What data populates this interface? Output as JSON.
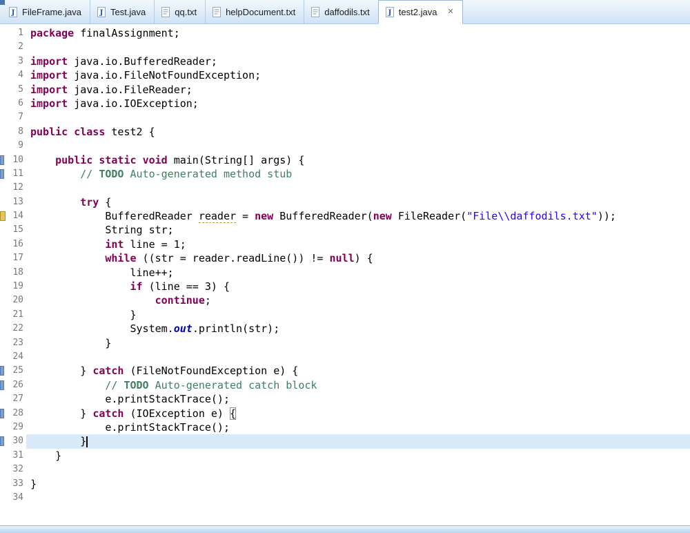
{
  "tab_close_glyph": "✕",
  "tabs": [
    {
      "label": "FileFrame.java",
      "type": "java",
      "active": false
    },
    {
      "label": "Test.java",
      "type": "java",
      "active": false
    },
    {
      "label": "qq.txt",
      "type": "txt",
      "active": false
    },
    {
      "label": "helpDocument.txt",
      "type": "txt",
      "active": false
    },
    {
      "label": "daffodils.txt",
      "type": "txt",
      "active": false
    },
    {
      "label": "test2.java",
      "type": "java",
      "active": true
    }
  ],
  "editor": {
    "language": "java",
    "line_count": 34,
    "current_line": 30,
    "cursor_line": 30,
    "markers": [
      {
        "line": 10,
        "color": "blue",
        "name": "range-marker"
      },
      {
        "line": 11,
        "color": "blue",
        "name": "task-marker"
      },
      {
        "line": 14,
        "color": "gold",
        "name": "warning-marker"
      },
      {
        "line": 25,
        "color": "blue",
        "name": "range-marker"
      },
      {
        "line": 26,
        "color": "blue",
        "name": "task-marker"
      },
      {
        "line": 28,
        "color": "blue",
        "name": "range-marker"
      },
      {
        "line": 30,
        "color": "blue",
        "name": "range-marker"
      }
    ],
    "lines": [
      [
        [
          "k",
          "package"
        ],
        [
          "p",
          " finalAssignment;"
        ]
      ],
      [],
      [
        [
          "k",
          "import"
        ],
        [
          "p",
          " java.io.BufferedReader;"
        ]
      ],
      [
        [
          "k",
          "import"
        ],
        [
          "p",
          " java.io.FileNotFoundException;"
        ]
      ],
      [
        [
          "k",
          "import"
        ],
        [
          "p",
          " java.io.FileReader;"
        ]
      ],
      [
        [
          "k",
          "import"
        ],
        [
          "p",
          " java.io.IOException;"
        ]
      ],
      [],
      [
        [
          "k",
          "public"
        ],
        [
          "p",
          " "
        ],
        [
          "k",
          "class"
        ],
        [
          "p",
          " test2 {"
        ]
      ],
      [],
      [
        [
          "p",
          "\t"
        ],
        [
          "k",
          "public"
        ],
        [
          "p",
          " "
        ],
        [
          "k",
          "static"
        ],
        [
          "p",
          " "
        ],
        [
          "k",
          "void"
        ],
        [
          "p",
          " main(String[] args) {"
        ]
      ],
      [
        [
          "c",
          "\t\t// "
        ],
        [
          "t",
          "TODO"
        ],
        [
          "c",
          " Auto-generated method stub"
        ]
      ],
      [],
      [
        [
          "p",
          "\t\t"
        ],
        [
          "k",
          "try"
        ],
        [
          "p",
          " {"
        ]
      ],
      [
        [
          "p",
          "\t\t\tBufferedReader "
        ],
        [
          "u",
          "reader"
        ],
        [
          "p",
          " = "
        ],
        [
          "k",
          "new"
        ],
        [
          "p",
          " BufferedReader("
        ],
        [
          "k",
          "new"
        ],
        [
          "p",
          " FileReader("
        ],
        [
          "s",
          "\"File\\\\daffodils.txt\""
        ],
        [
          "p",
          "));"
        ]
      ],
      [
        [
          "p",
          "\t\t\tString str;"
        ]
      ],
      [
        [
          "p",
          "\t\t\t"
        ],
        [
          "k",
          "int"
        ],
        [
          "p",
          " line = 1;"
        ]
      ],
      [
        [
          "p",
          "\t\t\t"
        ],
        [
          "k",
          "while"
        ],
        [
          "p",
          " ((str = reader.readLine()) != "
        ],
        [
          "k",
          "null"
        ],
        [
          "p",
          ") {"
        ]
      ],
      [
        [
          "p",
          "\t\t\t\tline++;"
        ]
      ],
      [
        [
          "p",
          "\t\t\t\t"
        ],
        [
          "k",
          "if"
        ],
        [
          "p",
          " (line == 3) {"
        ]
      ],
      [
        [
          "p",
          "\t\t\t\t\t"
        ],
        [
          "k",
          "continue"
        ],
        [
          "p",
          ";"
        ]
      ],
      [
        [
          "p",
          "\t\t\t\t}"
        ]
      ],
      [
        [
          "p",
          "\t\t\t\tSystem."
        ],
        [
          "f",
          "out"
        ],
        [
          "p",
          ".println(str);"
        ]
      ],
      [
        [
          "p",
          "\t\t\t}"
        ]
      ],
      [],
      [
        [
          "p",
          "\t\t} "
        ],
        [
          "k",
          "catch"
        ],
        [
          "p",
          " (FileNotFoundException e) {"
        ]
      ],
      [
        [
          "c",
          "\t\t\t// "
        ],
        [
          "t",
          "TODO"
        ],
        [
          "c",
          " Auto-generated catch block"
        ]
      ],
      [
        [
          "p",
          "\t\t\te.printStackTrace();"
        ]
      ],
      [
        [
          "p",
          "\t\t} "
        ],
        [
          "k",
          "catch"
        ],
        [
          "p",
          " (IOException e) "
        ],
        [
          "b",
          "{"
        ]
      ],
      [
        [
          "p",
          "\t\t\te.printStackTrace();"
        ]
      ],
      [
        [
          "p",
          "\t\t}"
        ],
        [
          "cur",
          ""
        ]
      ],
      [
        [
          "p",
          "\t}"
        ]
      ],
      [],
      [
        [
          "p",
          "}"
        ]
      ],
      []
    ]
  },
  "colors": {
    "keyword": "#7f0055",
    "comment": "#3f7f5f",
    "todo_tag": "#3f7f5f",
    "string": "#2a00ff",
    "static_field": "#0000c0",
    "line_number": "#787878",
    "current_line_bg": "#d9eafa",
    "tab_bar_top": "#f2f8fd",
    "tab_bar_bottom": "#cfe3f6",
    "marker_blue": "#7b9fd2",
    "marker_gold": "#e8c25c"
  }
}
